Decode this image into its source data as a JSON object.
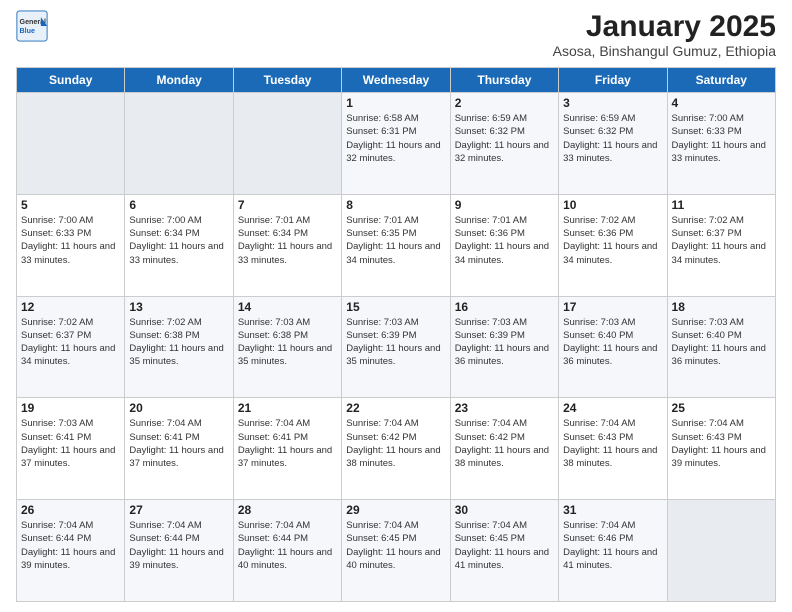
{
  "header": {
    "logo_line1": "General",
    "logo_line2": "Blue",
    "title": "January 2025",
    "subtitle": "Asosa, Binshangul Gumuz, Ethiopia"
  },
  "days_of_week": [
    "Sunday",
    "Monday",
    "Tuesday",
    "Wednesday",
    "Thursday",
    "Friday",
    "Saturday"
  ],
  "weeks": [
    [
      {
        "day": "",
        "sunrise": "",
        "sunset": "",
        "daylight": ""
      },
      {
        "day": "",
        "sunrise": "",
        "sunset": "",
        "daylight": ""
      },
      {
        "day": "",
        "sunrise": "",
        "sunset": "",
        "daylight": ""
      },
      {
        "day": "1",
        "sunrise": "6:58 AM",
        "sunset": "6:31 PM",
        "daylight": "11 hours and 32 minutes."
      },
      {
        "day": "2",
        "sunrise": "6:59 AM",
        "sunset": "6:32 PM",
        "daylight": "11 hours and 32 minutes."
      },
      {
        "day": "3",
        "sunrise": "6:59 AM",
        "sunset": "6:32 PM",
        "daylight": "11 hours and 33 minutes."
      },
      {
        "day": "4",
        "sunrise": "7:00 AM",
        "sunset": "6:33 PM",
        "daylight": "11 hours and 33 minutes."
      }
    ],
    [
      {
        "day": "5",
        "sunrise": "7:00 AM",
        "sunset": "6:33 PM",
        "daylight": "11 hours and 33 minutes."
      },
      {
        "day": "6",
        "sunrise": "7:00 AM",
        "sunset": "6:34 PM",
        "daylight": "11 hours and 33 minutes."
      },
      {
        "day": "7",
        "sunrise": "7:01 AM",
        "sunset": "6:34 PM",
        "daylight": "11 hours and 33 minutes."
      },
      {
        "day": "8",
        "sunrise": "7:01 AM",
        "sunset": "6:35 PM",
        "daylight": "11 hours and 34 minutes."
      },
      {
        "day": "9",
        "sunrise": "7:01 AM",
        "sunset": "6:36 PM",
        "daylight": "11 hours and 34 minutes."
      },
      {
        "day": "10",
        "sunrise": "7:02 AM",
        "sunset": "6:36 PM",
        "daylight": "11 hours and 34 minutes."
      },
      {
        "day": "11",
        "sunrise": "7:02 AM",
        "sunset": "6:37 PM",
        "daylight": "11 hours and 34 minutes."
      }
    ],
    [
      {
        "day": "12",
        "sunrise": "7:02 AM",
        "sunset": "6:37 PM",
        "daylight": "11 hours and 34 minutes."
      },
      {
        "day": "13",
        "sunrise": "7:02 AM",
        "sunset": "6:38 PM",
        "daylight": "11 hours and 35 minutes."
      },
      {
        "day": "14",
        "sunrise": "7:03 AM",
        "sunset": "6:38 PM",
        "daylight": "11 hours and 35 minutes."
      },
      {
        "day": "15",
        "sunrise": "7:03 AM",
        "sunset": "6:39 PM",
        "daylight": "11 hours and 35 minutes."
      },
      {
        "day": "16",
        "sunrise": "7:03 AM",
        "sunset": "6:39 PM",
        "daylight": "11 hours and 36 minutes."
      },
      {
        "day": "17",
        "sunrise": "7:03 AM",
        "sunset": "6:40 PM",
        "daylight": "11 hours and 36 minutes."
      },
      {
        "day": "18",
        "sunrise": "7:03 AM",
        "sunset": "6:40 PM",
        "daylight": "11 hours and 36 minutes."
      }
    ],
    [
      {
        "day": "19",
        "sunrise": "7:03 AM",
        "sunset": "6:41 PM",
        "daylight": "11 hours and 37 minutes."
      },
      {
        "day": "20",
        "sunrise": "7:04 AM",
        "sunset": "6:41 PM",
        "daylight": "11 hours and 37 minutes."
      },
      {
        "day": "21",
        "sunrise": "7:04 AM",
        "sunset": "6:41 PM",
        "daylight": "11 hours and 37 minutes."
      },
      {
        "day": "22",
        "sunrise": "7:04 AM",
        "sunset": "6:42 PM",
        "daylight": "11 hours and 38 minutes."
      },
      {
        "day": "23",
        "sunrise": "7:04 AM",
        "sunset": "6:42 PM",
        "daylight": "11 hours and 38 minutes."
      },
      {
        "day": "24",
        "sunrise": "7:04 AM",
        "sunset": "6:43 PM",
        "daylight": "11 hours and 38 minutes."
      },
      {
        "day": "25",
        "sunrise": "7:04 AM",
        "sunset": "6:43 PM",
        "daylight": "11 hours and 39 minutes."
      }
    ],
    [
      {
        "day": "26",
        "sunrise": "7:04 AM",
        "sunset": "6:44 PM",
        "daylight": "11 hours and 39 minutes."
      },
      {
        "day": "27",
        "sunrise": "7:04 AM",
        "sunset": "6:44 PM",
        "daylight": "11 hours and 39 minutes."
      },
      {
        "day": "28",
        "sunrise": "7:04 AM",
        "sunset": "6:44 PM",
        "daylight": "11 hours and 40 minutes."
      },
      {
        "day": "29",
        "sunrise": "7:04 AM",
        "sunset": "6:45 PM",
        "daylight": "11 hours and 40 minutes."
      },
      {
        "day": "30",
        "sunrise": "7:04 AM",
        "sunset": "6:45 PM",
        "daylight": "11 hours and 41 minutes."
      },
      {
        "day": "31",
        "sunrise": "7:04 AM",
        "sunset": "6:46 PM",
        "daylight": "11 hours and 41 minutes."
      },
      {
        "day": "",
        "sunrise": "",
        "sunset": "",
        "daylight": ""
      }
    ]
  ],
  "labels": {
    "sunrise": "Sunrise:",
    "sunset": "Sunset:",
    "daylight": "Daylight:"
  }
}
